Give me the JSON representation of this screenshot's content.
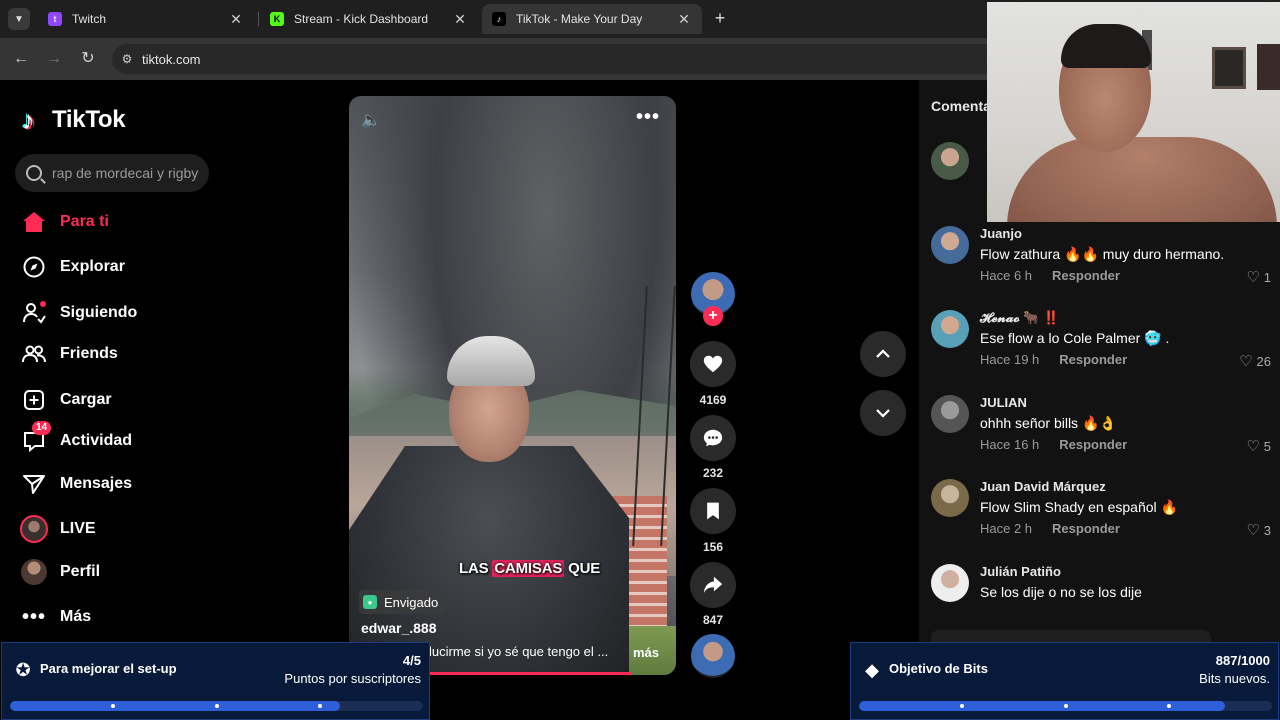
{
  "browser": {
    "tabs": [
      {
        "title": "Twitch",
        "favicon": "twitch-icon",
        "color": "#9146ff",
        "active": false
      },
      {
        "title": "Stream - Kick Dashboard",
        "favicon": "kick-icon",
        "color": "#53fc18",
        "active": false
      },
      {
        "title": "TikTok - Make Your Day",
        "favicon": "tiktok-icon",
        "color": "#000000",
        "active": true
      }
    ],
    "url": "tiktok.com"
  },
  "tiktok": {
    "brand": "TikTok",
    "search_placeholder": "rap de mordecai y rigby",
    "nav": [
      {
        "label": "Para ti",
        "icon": "home-icon",
        "active": true
      },
      {
        "label": "Explorar",
        "icon": "compass-icon"
      },
      {
        "label": "Siguiendo",
        "icon": "following-icon"
      },
      {
        "label": "Friends",
        "icon": "friends-icon"
      },
      {
        "label": "Cargar",
        "icon": "upload-icon"
      },
      {
        "label": "Actividad",
        "icon": "activity-icon",
        "badge": "14"
      },
      {
        "label": "Mensajes",
        "icon": "messages-icon"
      },
      {
        "label": "LIVE",
        "icon": "live-icon"
      },
      {
        "label": "Perfil",
        "icon": "profile-icon"
      },
      {
        "label": "Más",
        "icon": "more-icon"
      }
    ],
    "video": {
      "caption_prefix": "LAS ",
      "caption_highlight": "CAMISAS",
      "caption_suffix": " QUE",
      "location": "Envigado",
      "author": "edwar_.888",
      "description": "lucirme si yo sé que tengo el ...",
      "more": "más",
      "progress": 0.62
    },
    "actions": {
      "likes": "4169",
      "comments": "232",
      "saves": "156",
      "shares": "847"
    },
    "comments_title": "Comentarios",
    "comments": [
      {
        "name": "Juanjo",
        "text": "Flow zathura 🔥🔥 muy duro hermano.",
        "time": "Hace 6 h",
        "reply": "Responder",
        "likes": "1"
      },
      {
        "name": "𝓗𝓮𝓷𝓪𝓸 🐂 ‼️",
        "text": "Ese flow a lo Cole Palmer 🥶 .",
        "time": "Hace 19 h",
        "reply": "Responder",
        "likes": "26"
      },
      {
        "name": "JULIAN",
        "text": "ohhh señor bills 🔥👌",
        "time": "Hace 16 h",
        "reply": "Responder",
        "likes": "5"
      },
      {
        "name": "Juan David Márquez",
        "text": "Flow Slim Shady en español 🔥",
        "time": "Hace 2 h",
        "reply": "Responder",
        "likes": "3"
      },
      {
        "name": "Julián Patiño",
        "text": "Se los dije o no se los dije",
        "time": "",
        "reply": "",
        "likes": ""
      }
    ]
  },
  "widgets": {
    "left": {
      "title": "Para mejorar el set-up",
      "count": "4/5",
      "subtitle": "Puntos por suscriptores",
      "progress": 0.8
    },
    "right": {
      "title": "Objetivo de Bits",
      "count": "887/1000",
      "subtitle": "Bits nuevos.",
      "progress": 0.887
    }
  }
}
